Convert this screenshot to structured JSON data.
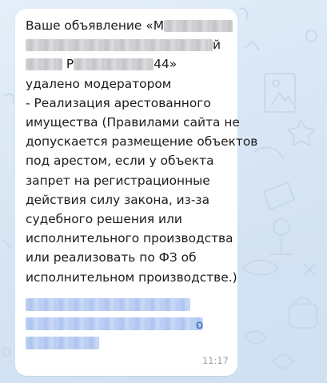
{
  "message": {
    "text_lines": [
      "Ваше объявление «М",
      "",
      "",
      "удалено модератором",
      "- Реализация арестованного",
      "имущества (Правилами сайта не",
      "допускается размещение объектов",
      "под арестом, если у объекта",
      "запрет на регистрационные",
      "действия силу закона, из-за",
      "судебного решения или",
      "исполнительного производства",
      "или реализовать по ФЗ об",
      "исполнительном производстве.)"
    ],
    "line2_suffix": "й",
    "line3_prefix": "",
    "line3_middle": "Р",
    "line3_suffix": "44»",
    "link_tail": "о",
    "time": "11:17"
  },
  "colors": {
    "chat_background": "#dbe8f6",
    "bubble": "#ffffff",
    "text": "#1b1b1b",
    "time": "#9aa2ab",
    "link": "#2a5fb0"
  }
}
